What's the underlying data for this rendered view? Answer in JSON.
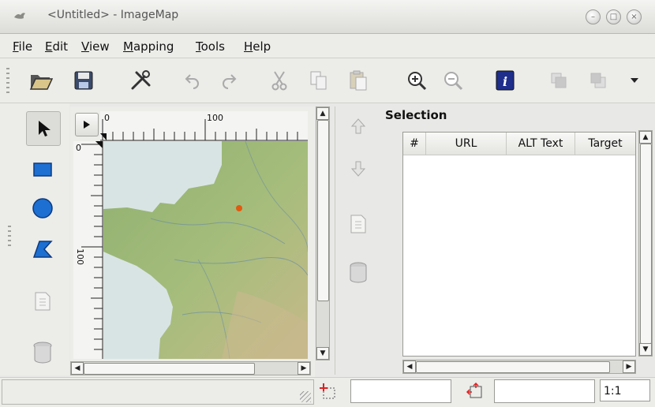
{
  "window": {
    "title": "<Untitled> - ImageMap",
    "controls": [
      "minimize-icon",
      "maximize-icon",
      "close-icon"
    ]
  },
  "menubar": {
    "items": [
      {
        "label": "File",
        "mnemonic": "F",
        "rest": "ile"
      },
      {
        "label": "Edit",
        "mnemonic": "E",
        "rest": "dit"
      },
      {
        "label": "View",
        "mnemonic": "V",
        "rest": "iew"
      },
      {
        "label": "Mapping",
        "mnemonic": "M",
        "rest": "apping"
      },
      {
        "label": "Tools",
        "mnemonic": "T",
        "rest": "ools"
      },
      {
        "label": "Help",
        "mnemonic": "H",
        "rest": "elp"
      }
    ]
  },
  "toolbar": {
    "buttons": [
      "open-icon",
      "save-icon",
      "preferences-icon",
      "undo-icon",
      "redo-icon",
      "cut-icon",
      "copy-icon",
      "paste-icon",
      "zoom-in-icon",
      "zoom-out-icon",
      "info-icon",
      "bring-to-front-icon",
      "send-to-back-icon",
      "overflow-arrow-icon"
    ]
  },
  "tools": [
    "arrow-icon",
    "rectangle-icon",
    "circle-icon",
    "polygon-icon",
    "edit-area-icon",
    "delete-icon"
  ],
  "rulers": {
    "top_labels": [
      "0",
      "100"
    ],
    "left_labels": [
      "0",
      "100"
    ]
  },
  "selection": {
    "title": "Selection",
    "columns": [
      "#",
      "URL",
      "ALT Text",
      "Target"
    ],
    "rows": []
  },
  "statusbar": {
    "zoom": "1:1"
  },
  "colors": {
    "selected_dot": "#e05a10",
    "map_green": "#8fb070",
    "sea": "#d8e4e4"
  }
}
